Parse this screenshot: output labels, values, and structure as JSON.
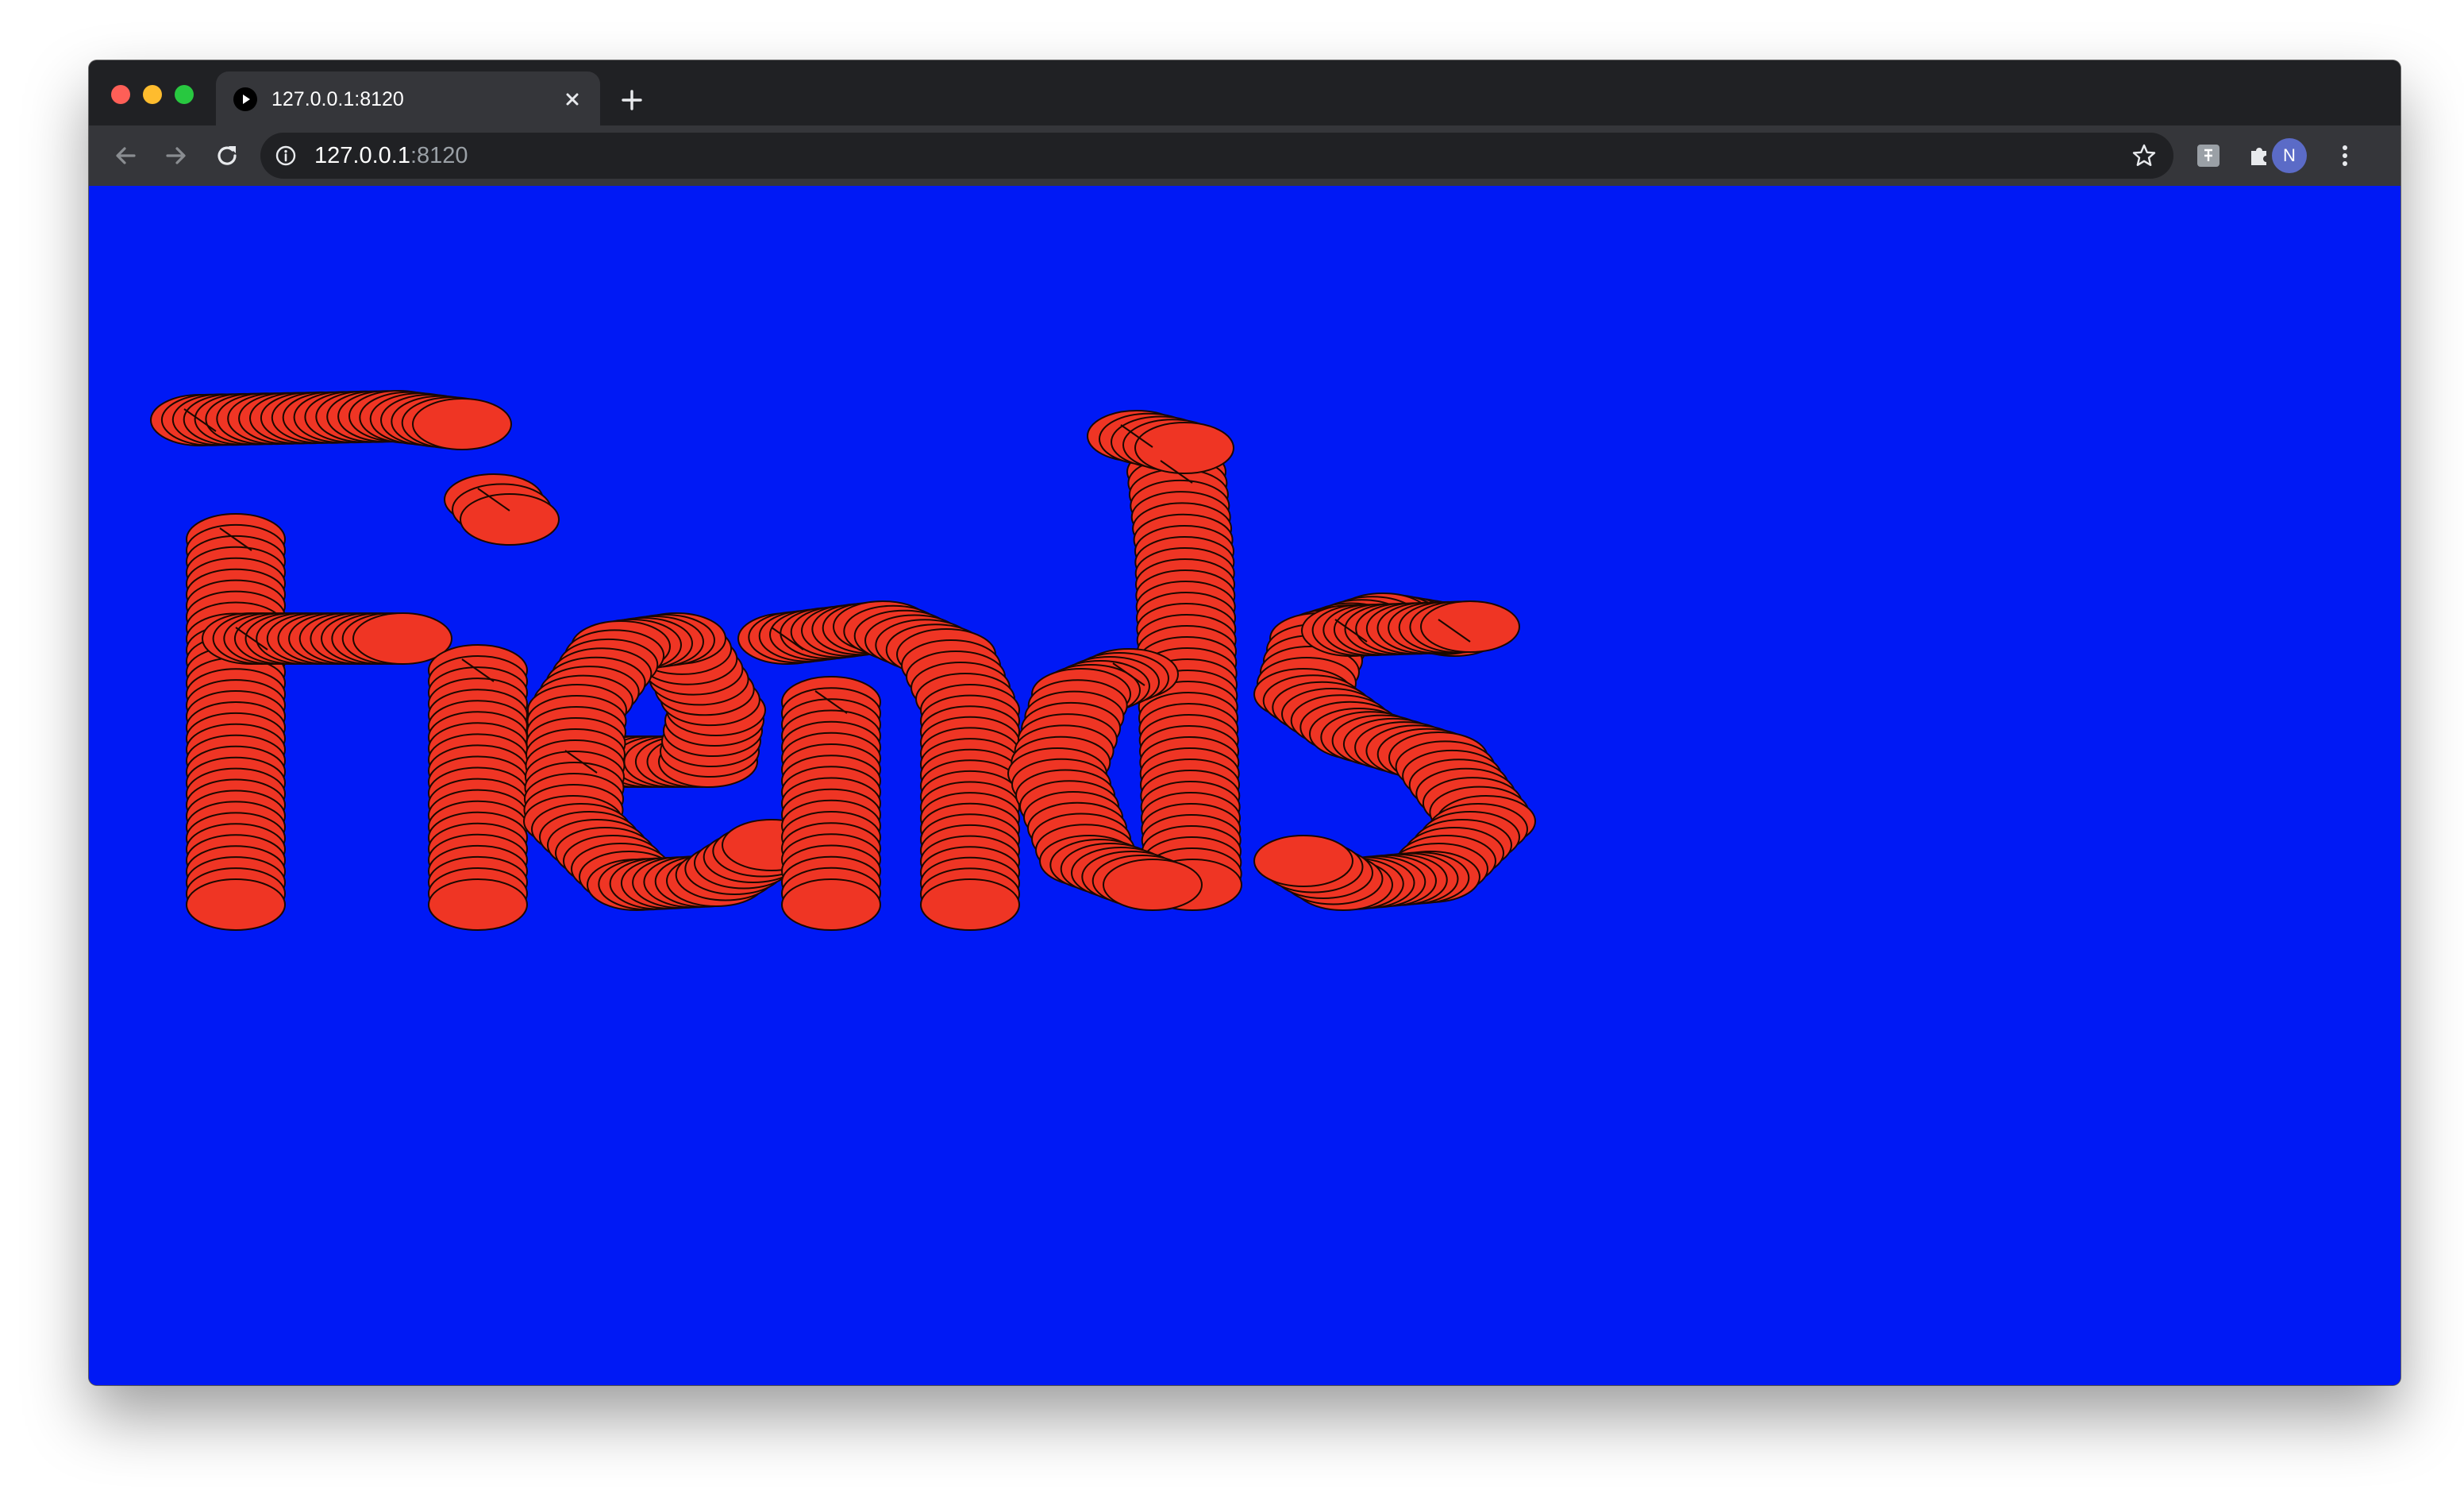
{
  "browser": {
    "tab": {
      "title": "127.0.0.1:8120"
    },
    "omnibox": {
      "host": "127.0.0.1",
      "port": ":8120"
    },
    "profile_initial": "N"
  },
  "page": {
    "background_color": "#0019f5",
    "disc_color": "#ef3524",
    "outline_color": "#1a0800",
    "word": "Fiends"
  }
}
